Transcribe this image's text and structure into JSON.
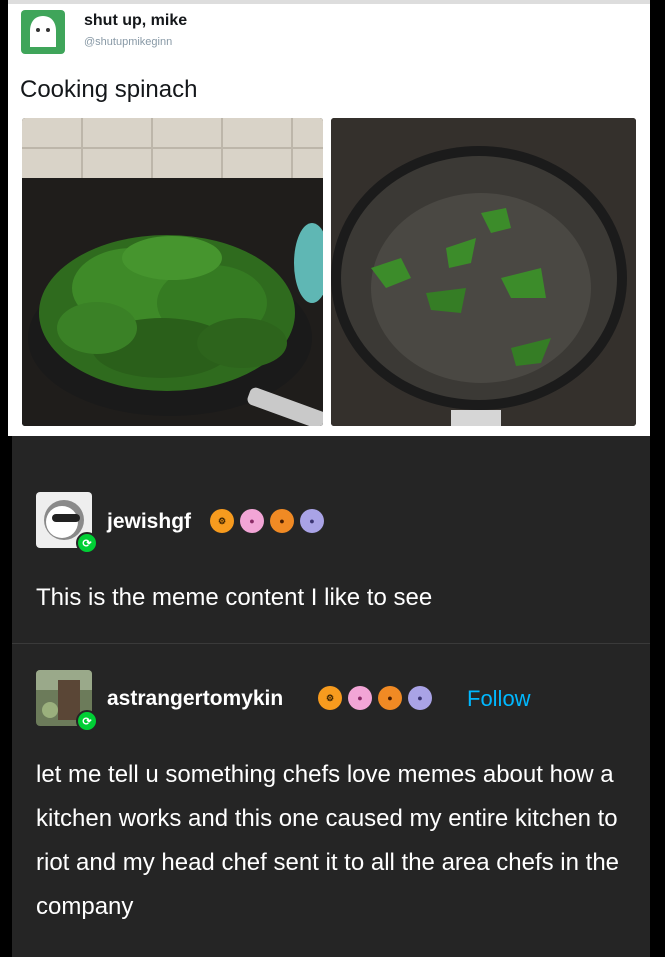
{
  "tweet": {
    "author_name": "shut up, mike",
    "author_handle": "@shutupmikeginn",
    "text": "Cooking spinach",
    "photos": [
      "raw spinach piled in frying pan",
      "wilted spinach in frying pan"
    ]
  },
  "reblogs": [
    {
      "username": "jewishgf",
      "text": "This is the meme content I like to see",
      "badges": [
        "orange-gear-badge",
        "pink-paw-badge",
        "amber-paw-badge",
        "violet-paw-badge"
      ]
    },
    {
      "username": "astrangertomykin",
      "follow_label": "Follow",
      "text": "let me tell u something chefs love memes about how a kitchen works and this one caused my entire kitchen to riot and my head chef sent it to all the area chefs in the company",
      "badges": [
        "orange-gear-badge",
        "pink-paw-badge",
        "amber-paw-badge",
        "violet-paw-badge"
      ]
    }
  ],
  "colors": {
    "background": "#252525",
    "link": "#00b8ff",
    "reblog_icon": "#00cf35"
  }
}
